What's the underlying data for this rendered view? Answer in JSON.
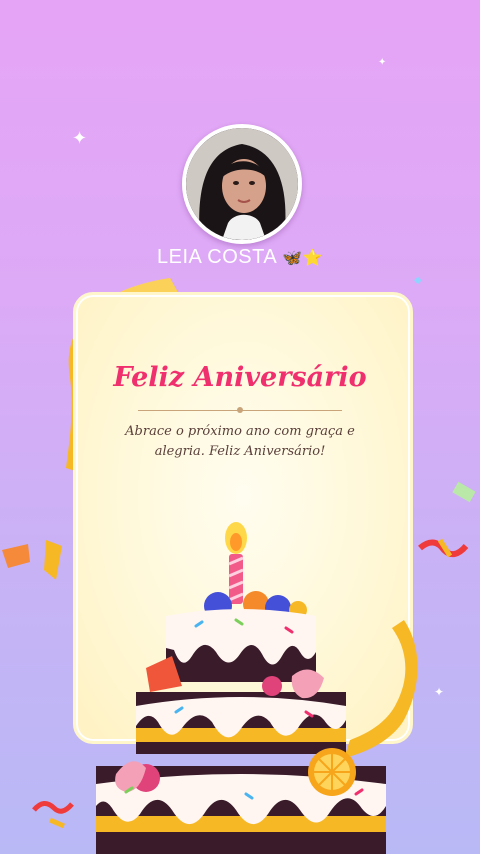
{
  "profile": {
    "name": "LEIA COSTA",
    "badges": "🦋⭐"
  },
  "card": {
    "title": "Feliz Aniversário",
    "message": "Abrace o próximo ano com graça e alegria. Feliz Aniversário!"
  },
  "colors": {
    "title": "#f0306e",
    "background_top": "#e6a4f6",
    "background_bottom": "#b9b9f6",
    "card": "#fff8d8",
    "ribbon": "#f7b825"
  },
  "icons": [
    "sparkle-icon",
    "butterfly-emoji",
    "star-emoji",
    "candle-icon",
    "birthday-cake-illustration"
  ]
}
